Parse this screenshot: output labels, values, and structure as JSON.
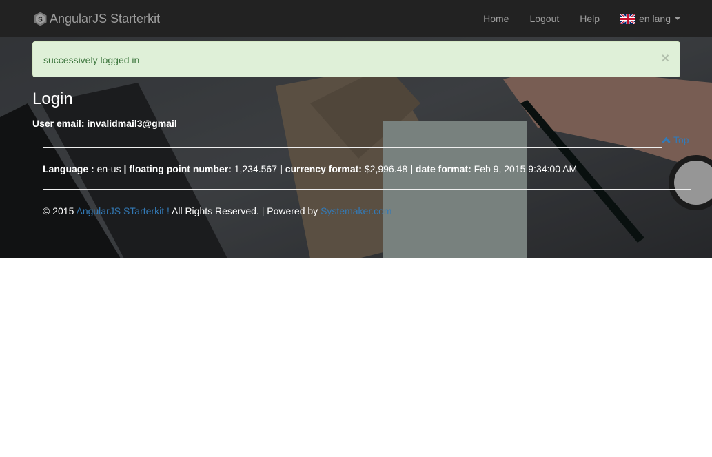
{
  "navbar": {
    "brand": "AngularJS Starterkit",
    "links": [
      "Home",
      "Logout",
      "Help"
    ],
    "lang_label": "en lang"
  },
  "alert": {
    "message": "successively logged in",
    "close_label": "×"
  },
  "page": {
    "title": "Login",
    "user_email_label": "User email:",
    "user_email_value": "invalidmail3@gmail",
    "top_link": "Top"
  },
  "info": {
    "language_label": "Language :",
    "language_value": "en-us",
    "float_label": "floating point number:",
    "float_value": "1,234.567",
    "currency_label": "currency format:",
    "currency_value": "$2,996.48",
    "date_label": "date format:",
    "date_value": "Feb 9, 2015 9:34:00 AM",
    "sep": "|"
  },
  "footer": {
    "copyright": "© 2015",
    "app_link": "AngularJS STarterkit !",
    "rights": "All Rights Reserved. | Powered by",
    "powered_link": "Systemaker.com"
  },
  "colors": {
    "navbar_bg": "#222222",
    "alert_bg": "#dff0d8",
    "alert_text": "#3c763d",
    "link": "#337ab7"
  },
  "icons": [
    "brand-logo-icon",
    "uk-flag-icon",
    "caret-down-icon",
    "chevron-up-icon",
    "close-icon"
  ]
}
